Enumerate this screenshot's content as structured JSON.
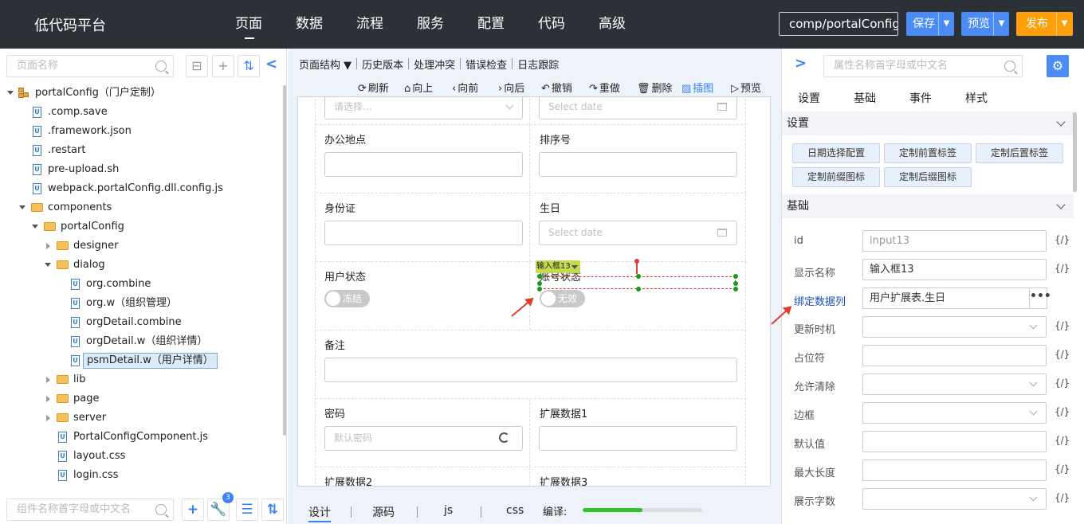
{
  "app": {
    "brand": "低代码平台",
    "nav": [
      "页面",
      "数据",
      "流程",
      "服务",
      "配置",
      "代码",
      "高级"
    ],
    "component_path": "comp/portalConfig",
    "save_label": "保存",
    "preview_label": "预览",
    "publish_label": "发布"
  },
  "left": {
    "search_placeholder": "页面名称",
    "tree": [
      {
        "label": "portalConfig（门户定制）"
      },
      {
        "label": ".comp.save"
      },
      {
        "label": ".framework.json"
      },
      {
        "label": ".restart"
      },
      {
        "label": "pre-upload.sh"
      },
      {
        "label": "webpack.portalConfig.dll.config.js"
      },
      {
        "label": "components"
      },
      {
        "label": "portalConfig"
      },
      {
        "label": "designer"
      },
      {
        "label": "dialog"
      },
      {
        "label": "org.combine"
      },
      {
        "label": "org.w（组织管理）"
      },
      {
        "label": "orgDetail.combine"
      },
      {
        "label": "orgDetail.w（组织详情）"
      },
      {
        "label": "psmDetail.w（用户详情）"
      },
      {
        "label": "lib"
      },
      {
        "label": "page"
      },
      {
        "label": "server"
      },
      {
        "label": "PortalConfigComponent.js"
      },
      {
        "label": "layout.css"
      },
      {
        "label": "login.css"
      }
    ],
    "bottom_search_placeholder": "组件名称首字母或中文名",
    "badge_count": "3"
  },
  "middle": {
    "menu": [
      "页面结构 ▼",
      "历史版本",
      "处理冲突",
      "错误检查",
      "日志跟踪"
    ],
    "toolbar": {
      "refresh": "刷新",
      "up": "向上",
      "forward": "向前",
      "back": "向后",
      "undo": "撤销",
      "redo": "重做",
      "delete": "删除",
      "screenshot": "插图",
      "preview": "预览"
    },
    "form": {
      "top_left_placeholder": "请选择...",
      "top_right_placeholder": "Select date",
      "office_label": "办公地点",
      "sort_label": "排序号",
      "idcard_label": "身份证",
      "birthday_label": "生日",
      "birthday_placeholder": "Select date",
      "user_status_label": "用户状态",
      "user_status_value": "冻结",
      "account_status_label": "账号状态",
      "account_status_value": "无效",
      "remark_label": "备注",
      "password_label": "密码",
      "password_placeholder": "默认密码",
      "ext1_label": "扩展数据1",
      "ext2_label": "扩展数据2",
      "ext3_label": "扩展数据3"
    },
    "selection_tag": "输入框13",
    "bottom_tabs": [
      "设计",
      "源码",
      "js",
      "css"
    ],
    "compile_label": "编译:",
    "compile_progress": 0.5
  },
  "right": {
    "search_placeholder": "属性名称首字母或中文名",
    "tabs": [
      "设置",
      "基础",
      "事件",
      "样式"
    ],
    "settings_header": "设置",
    "setting_buttons": [
      "日期选择配置",
      "定制前置标签",
      "定制后置标签",
      "定制前缀图标",
      "定制后缀图标"
    ],
    "basic_header": "基础",
    "props": [
      {
        "label": "id",
        "value": ""
      },
      {
        "label": "显示名称",
        "value": "输入框13"
      },
      {
        "label": "绑定数据列",
        "value": "用户扩展表.生日"
      },
      {
        "label": "更新时机",
        "value": ""
      },
      {
        "label": "占位符",
        "value": ""
      },
      {
        "label": "允许清除",
        "value": ""
      },
      {
        "label": "边框",
        "value": ""
      },
      {
        "label": "默认值",
        "value": ""
      },
      {
        "label": "最大长度",
        "value": ""
      },
      {
        "label": "展示字数",
        "value": ""
      }
    ],
    "id_placeholder": "input13",
    "expr_label": "{/}",
    "dots": "•••"
  }
}
